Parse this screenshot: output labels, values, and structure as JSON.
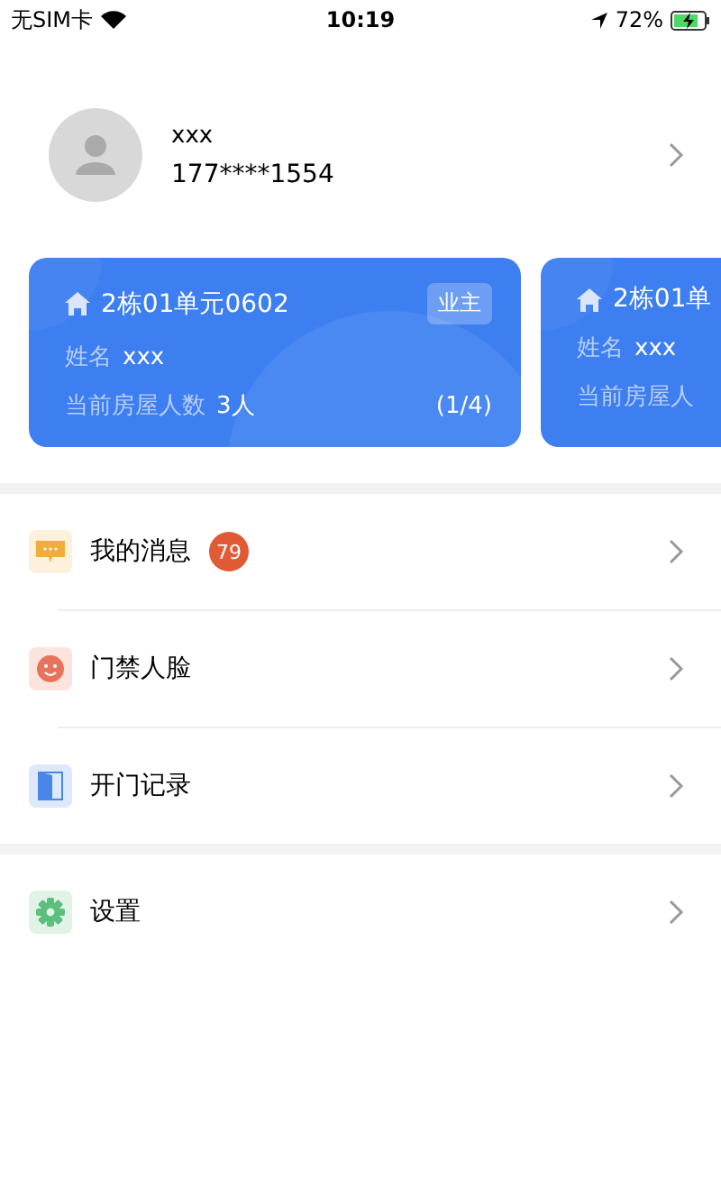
{
  "status_bar": {
    "carrier": "无SIM卡",
    "time": "10:19",
    "battery": "72%"
  },
  "profile": {
    "name": "xxx",
    "phone": "177****1554"
  },
  "house_cards": [
    {
      "title": "2栋01单元0602",
      "role": "业主",
      "name_label": "姓名",
      "name": "xxx",
      "count_label": "当前房屋人数",
      "count": "3人",
      "page": "(1/4)"
    },
    {
      "title": "2栋01单",
      "name_label": "姓名",
      "name": "xxx",
      "count_label": "当前房屋人"
    }
  ],
  "menu_groups": [
    [
      {
        "kind": "messages",
        "label": "我的消息",
        "badge": "79"
      },
      {
        "kind": "face",
        "label": "门禁人脸"
      },
      {
        "kind": "door",
        "label": "开门记录"
      }
    ],
    [
      {
        "kind": "settings",
        "label": "设置"
      }
    ]
  ]
}
